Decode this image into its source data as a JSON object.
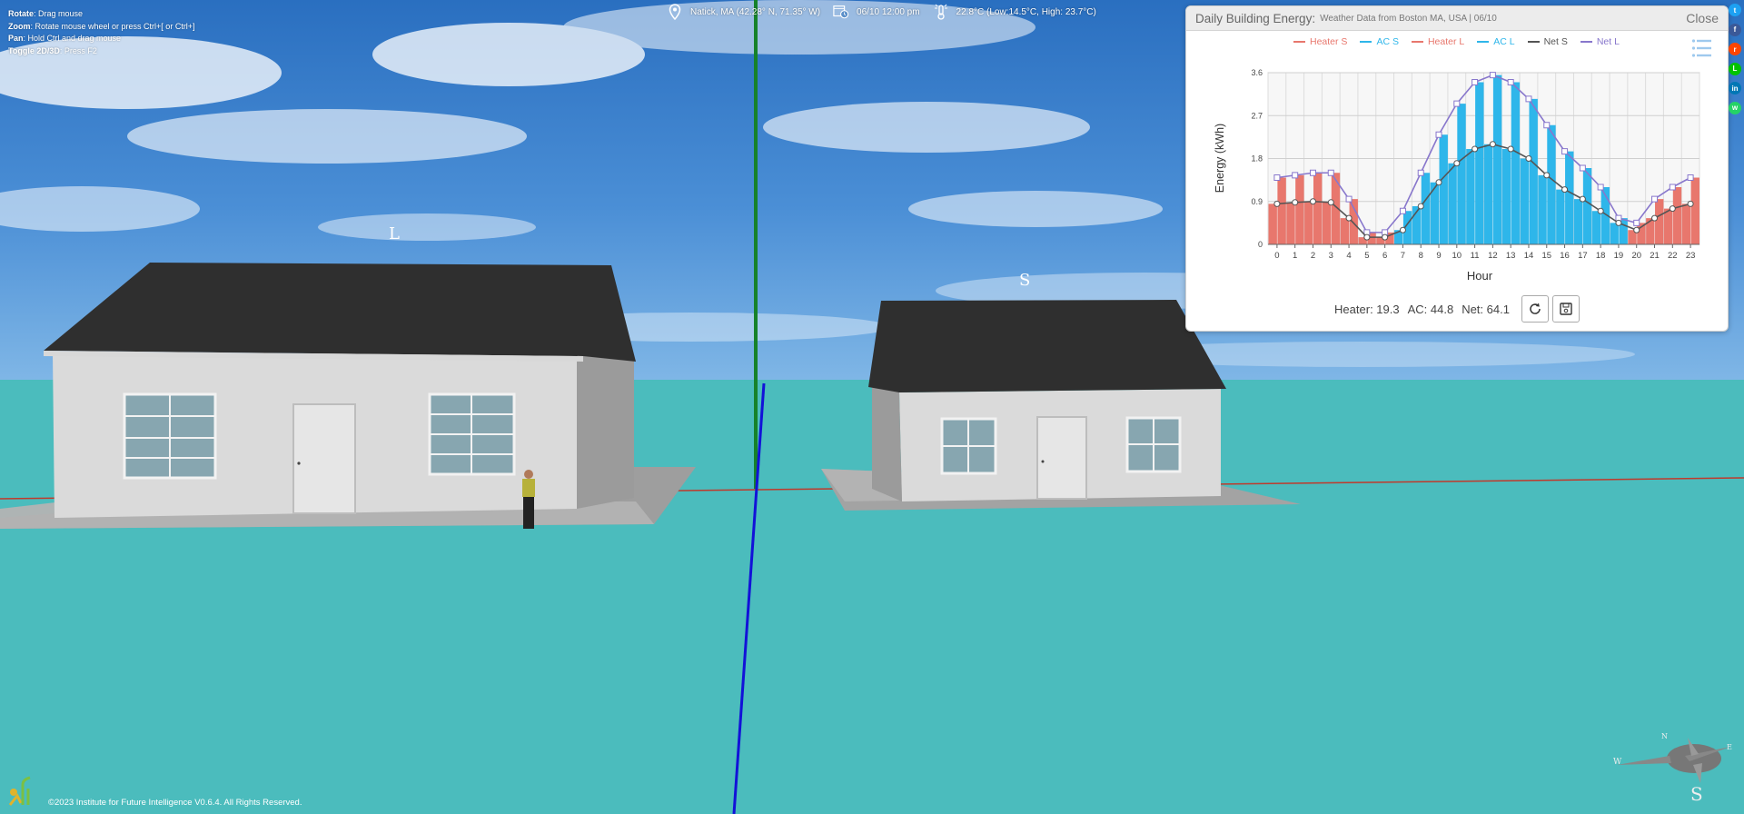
{
  "help": [
    {
      "key": "Rotate",
      "text": ": Drag mouse"
    },
    {
      "key": "Zoom",
      "text": ": Rotate mouse wheel or press Ctrl+[ or Ctrl+]"
    },
    {
      "key": "Pan",
      "text": ": Hold Ctrl and drag mouse"
    },
    {
      "key": "Toggle 2D/3D",
      "text": ": Press F2"
    }
  ],
  "status": {
    "location": "Natick, MA (42.28° N, 71.35° W)",
    "datetime": "06/10 12:00 pm",
    "weather": "22.8°C (Low:14.5°C, High: 23.7°C)"
  },
  "scene": {
    "label_L": "L",
    "label_S": "S",
    "compass_s": "S",
    "compass_n": "N",
    "compass_e": "E",
    "compass_w": "W"
  },
  "panel": {
    "title": "Daily Building Energy:",
    "subtitle": "Weather Data from Boston MA, USA | 06/10",
    "close_label": "Close",
    "footer": {
      "heater": "Heater: 19.3",
      "ac": "AC: 44.8",
      "net": "Net: 64.1"
    }
  },
  "colors": {
    "heater": "#e8776d",
    "ac": "#2eb6ea",
    "netS": "#555555",
    "netL": "#8877cc"
  },
  "chart_data": {
    "type": "bar",
    "xlabel": "Hour",
    "ylabel": "Energy (kWh)",
    "ylim": [
      0,
      3.6
    ],
    "yticks": [
      "0",
      "0.9",
      "1.8",
      "2.7",
      "3.6"
    ],
    "categories": [
      "0",
      "1",
      "2",
      "3",
      "4",
      "5",
      "6",
      "7",
      "8",
      "9",
      "10",
      "11",
      "12",
      "13",
      "14",
      "15",
      "16",
      "17",
      "18",
      "19",
      "20",
      "21",
      "22",
      "23"
    ],
    "series": [
      {
        "name": "Heater S",
        "values": [
          0.85,
          0.88,
          0.9,
          0.88,
          0.55,
          0.15,
          0.15,
          0,
          0,
          0,
          0,
          0,
          0,
          0,
          0,
          0,
          0,
          0,
          0,
          0,
          0.3,
          0.55,
          0.75,
          0.85
        ]
      },
      {
        "name": "AC S",
        "values": [
          0,
          0,
          0,
          0,
          0,
          0,
          0,
          0.3,
          0.8,
          1.3,
          1.7,
          2.0,
          2.1,
          2.0,
          1.8,
          1.45,
          1.15,
          0.95,
          0.7,
          0.45,
          0,
          0,
          0,
          0
        ]
      },
      {
        "name": "Heater L",
        "values": [
          1.4,
          1.45,
          1.5,
          1.5,
          0.95,
          0.25,
          0.25,
          0,
          0,
          0,
          0,
          0,
          0,
          0,
          0,
          0,
          0,
          0,
          0,
          0,
          0.45,
          0.95,
          1.2,
          1.4
        ]
      },
      {
        "name": "AC L",
        "values": [
          0,
          0,
          0,
          0,
          0,
          0,
          0,
          0.7,
          1.5,
          2.3,
          2.95,
          3.4,
          3.55,
          3.4,
          3.05,
          2.5,
          1.95,
          1.6,
          1.2,
          0.55,
          0,
          0,
          0,
          0
        ]
      },
      {
        "name": "Net S",
        "values": [
          0.85,
          0.88,
          0.9,
          0.88,
          0.55,
          0.15,
          0.15,
          0.3,
          0.8,
          1.3,
          1.7,
          2.0,
          2.1,
          2.0,
          1.8,
          1.45,
          1.15,
          0.95,
          0.7,
          0.45,
          0.3,
          0.55,
          0.75,
          0.85
        ]
      },
      {
        "name": "Net L",
        "values": [
          1.4,
          1.45,
          1.5,
          1.5,
          0.95,
          0.25,
          0.25,
          0.7,
          1.5,
          2.3,
          2.95,
          3.4,
          3.55,
          3.4,
          3.05,
          2.5,
          1.95,
          1.6,
          1.2,
          0.55,
          0.45,
          0.95,
          1.2,
          1.4
        ]
      }
    ],
    "legend": "top",
    "grid": true
  },
  "share": [
    {
      "name": "twitter",
      "glyph": "t",
      "color": "#1da1f2"
    },
    {
      "name": "facebook",
      "glyph": "f",
      "color": "#3b5998"
    },
    {
      "name": "reddit",
      "glyph": "r",
      "color": "#ff4500"
    },
    {
      "name": "line",
      "glyph": "L",
      "color": "#00c300"
    },
    {
      "name": "linkedin",
      "glyph": "in",
      "color": "#0077b5"
    },
    {
      "name": "whatsapp",
      "glyph": "w",
      "color": "#25d366"
    }
  ],
  "copyright": "©2023 Institute for Future Intelligence V0.6.4. All Rights Reserved."
}
